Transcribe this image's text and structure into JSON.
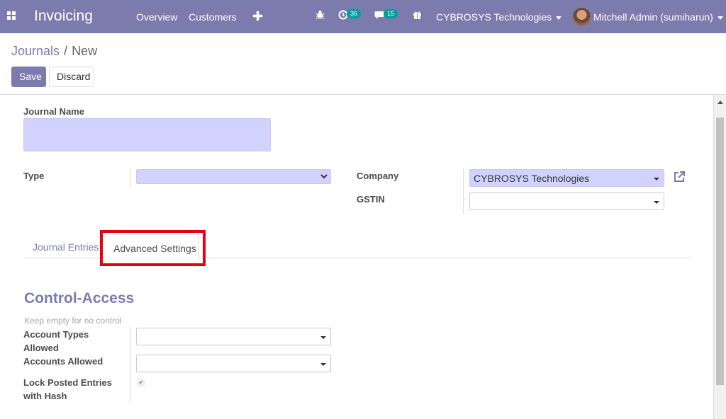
{
  "navbar": {
    "app_name": "Invoicing",
    "menu": [
      "Overview",
      "Customers"
    ],
    "activity_count": "36",
    "message_count": "15",
    "company": "CYBROSYS Technologies",
    "user": "Mitchell Admin (sumiharun)"
  },
  "breadcrumb": {
    "parent": "Journals",
    "separator": "/",
    "current": "New"
  },
  "actions": {
    "save": "Save",
    "discard": "Discard"
  },
  "form": {
    "journal_name_label": "Journal Name",
    "journal_name_value": "",
    "type_label": "Type",
    "type_value": "",
    "company_label": "Company",
    "company_value": "CYBROSYS Technologies",
    "gstin_label": "GSTIN",
    "gstin_value": ""
  },
  "tabs": [
    "Journal Entries",
    "Advanced Settings"
  ],
  "advanced": {
    "section_title": "Control-Access",
    "help_text": "Keep empty for no control",
    "account_types_label_1": "Account Types",
    "account_types_label_2": "Allowed",
    "accounts_allowed_label": "Accounts Allowed",
    "lock_label_1": "Lock Posted Entries",
    "lock_label_2": "with Hash",
    "lock_checked": true
  },
  "colors": {
    "primary": "#7c7bad",
    "required_field": "#d2d2ff",
    "badge": "#00a09d",
    "highlight": "#e60012"
  }
}
